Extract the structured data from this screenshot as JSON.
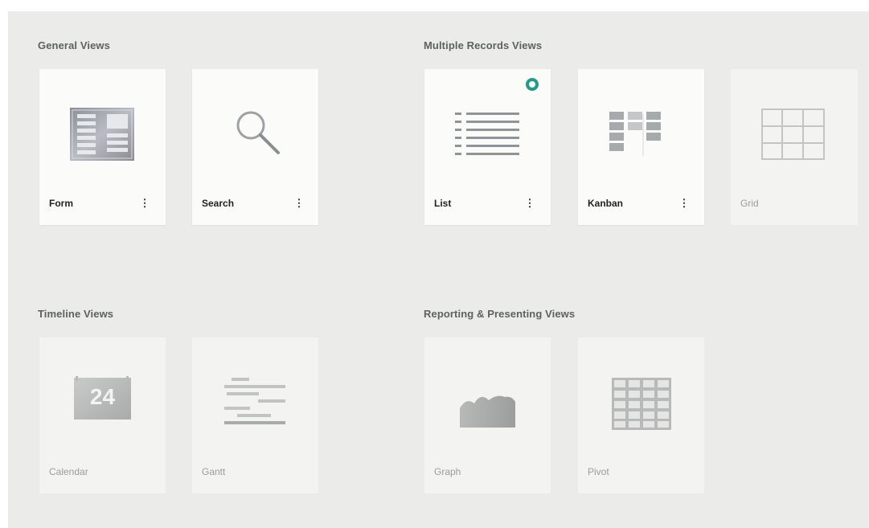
{
  "sections": {
    "general": {
      "title": "General Views",
      "cards": [
        {
          "label": "Form",
          "icon": "form-icon",
          "active": true,
          "menu": "⋮"
        },
        {
          "label": "Search",
          "icon": "search-icon",
          "active": true,
          "menu": "⋮"
        }
      ]
    },
    "multiple": {
      "title": "Multiple Records Views",
      "cards": [
        {
          "label": "List",
          "icon": "list-icon",
          "active": true,
          "menu": "⋮",
          "selected": true
        },
        {
          "label": "Kanban",
          "icon": "kanban-icon",
          "active": true,
          "menu": "⋮"
        },
        {
          "label": "Grid",
          "icon": "grid-icon",
          "active": false
        }
      ]
    },
    "timeline": {
      "title": "Timeline Views",
      "cards": [
        {
          "label": "Calendar",
          "icon": "calendar-icon",
          "active": false,
          "day": "24"
        },
        {
          "label": "Gantt",
          "icon": "gantt-icon",
          "active": false
        }
      ]
    },
    "reporting": {
      "title": "Reporting & Presenting Views",
      "cards": [
        {
          "label": "Graph",
          "icon": "graph-icon",
          "active": false
        },
        {
          "label": "Pivot",
          "icon": "pivot-icon",
          "active": false
        }
      ]
    }
  },
  "colors": {
    "background": "#ebecea",
    "card": "#fbfbf9",
    "selected_badge": "#1f9c84"
  }
}
